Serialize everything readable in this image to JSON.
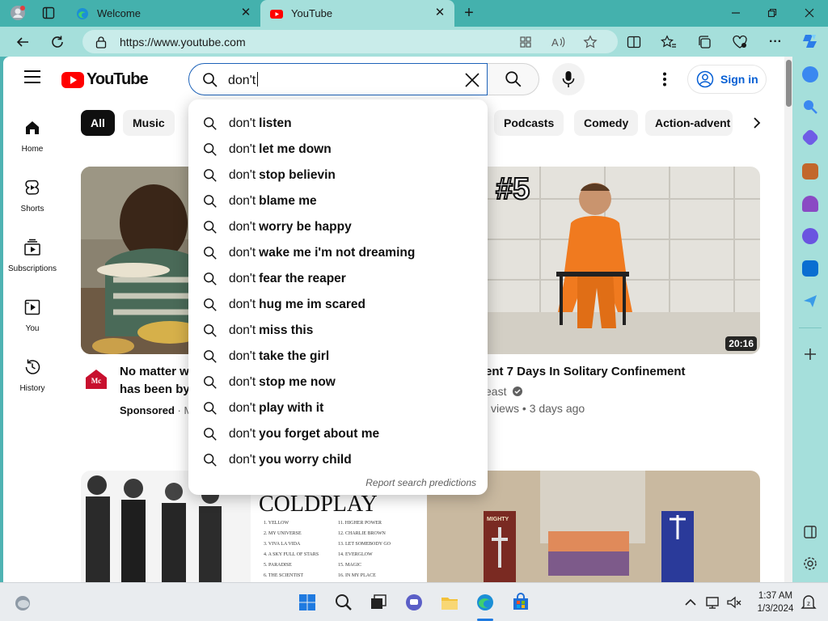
{
  "browser": {
    "tabs": [
      {
        "label": "Welcome",
        "active": false
      },
      {
        "label": "YouTube",
        "active": true
      }
    ],
    "url": "https://www.youtube.com",
    "new_tab_symbol": "+"
  },
  "youtube": {
    "logo_text": "YouTube",
    "search": {
      "query": "don't"
    },
    "signin_label": "Sign in",
    "guide": [
      {
        "label": "Home",
        "icon": "home-icon"
      },
      {
        "label": "Shorts",
        "icon": "shorts-icon"
      },
      {
        "label": "Subscriptions",
        "icon": "subscriptions-icon"
      },
      {
        "label": "You",
        "icon": "you-icon"
      },
      {
        "label": "History",
        "icon": "history-icon"
      }
    ],
    "chips": [
      {
        "label": "All",
        "active": true
      },
      {
        "label": "Music",
        "active": false
      },
      {
        "label": "Podcasts",
        "active": false
      },
      {
        "label": "Comedy",
        "active": false
      },
      {
        "label": "Action-advent",
        "active": false
      }
    ],
    "suggestions": [
      {
        "prefix": "don't",
        "rest": "listen"
      },
      {
        "prefix": "don't",
        "rest": "let me down"
      },
      {
        "prefix": "don't",
        "rest": "stop believin"
      },
      {
        "prefix": "don't",
        "rest": "blame me"
      },
      {
        "prefix": "don't",
        "rest": "worry be happy"
      },
      {
        "prefix": "don't",
        "rest": "wake me i'm not dreaming"
      },
      {
        "prefix": "don't",
        "rest": "fear the reaper"
      },
      {
        "prefix": "don't",
        "rest": "hug me im scared"
      },
      {
        "prefix": "don't",
        "rest": "miss this"
      },
      {
        "prefix": "don't",
        "rest": "take the girl"
      },
      {
        "prefix": "don't",
        "rest": "stop me now"
      },
      {
        "prefix": "don't",
        "rest": "play with it"
      },
      {
        "prefix": "don't",
        "rest": "you forget about me"
      },
      {
        "prefix": "don't",
        "rest": "you worry child"
      }
    ],
    "report_label": "Report search predictions",
    "videos": [
      {
        "title_lines": [
          "No matter w",
          "has been by"
        ],
        "meta_bold": "Sponsored",
        "meta_rest": " · M",
        "channel_logo_text": "McCormick"
      },
      {
        "title": "ent 7 Days In Solitary Confinement",
        "channel": "east",
        "verified": true,
        "stats": "views • 3 days ago",
        "duration": "20:16",
        "thumb_text": "#5"
      },
      {
        "thumb_text": "COLDPLAY",
        "tracklist_left": [
          "1. YELLOW",
          "2. MY UNIVERSE",
          "3. VIVA LA VIDA",
          "4. A SKY FULL OF STARS",
          "5. PARADISE",
          "6. THE SCIENTIST"
        ],
        "tracklist_right": [
          "11. HIGHER POWER",
          "12. CHARLIE BROWN",
          "13. LET SOMEBODY GO",
          "14. EVERGLOW",
          "15. MAGIC",
          "16. IN MY PLACE"
        ]
      },
      {
        "thumb_text": "MIGHTY"
      }
    ]
  },
  "taskbar": {
    "time": "1:37 AM",
    "date": "1/3/2024"
  },
  "colors": {
    "accent": "#065fd4",
    "brand_red": "#ff0000",
    "frame": "#44b1ad"
  }
}
